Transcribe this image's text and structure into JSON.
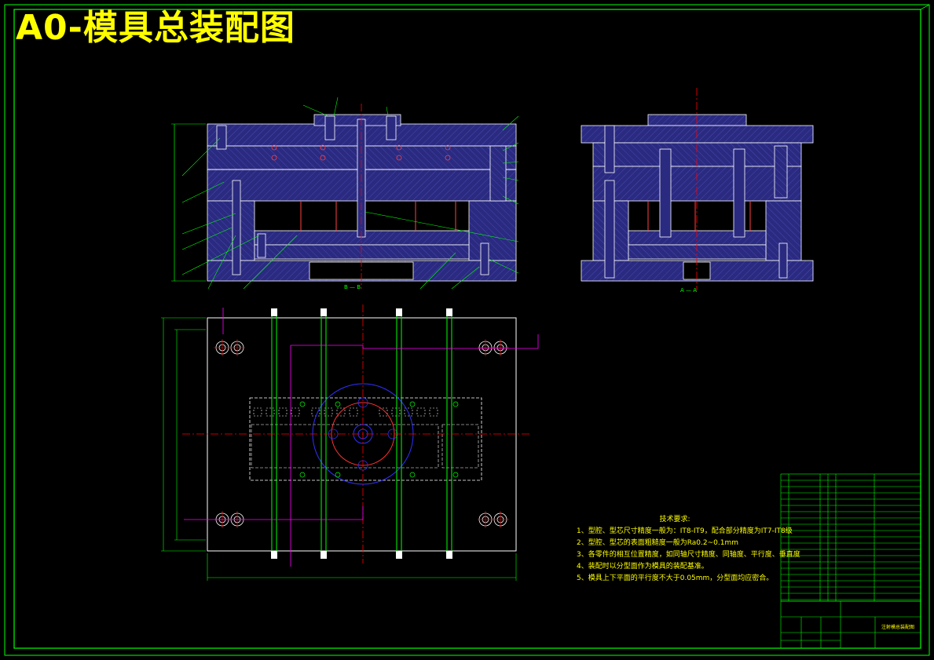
{
  "drawing": {
    "title": "A0-模具总装配图",
    "tech_requirements": {
      "heading": "技术要求:",
      "items": [
        "1、型腔、型芯尺寸精度一般为：IT8-IT9，配合部分精度为IT7-IT8级",
        "2、型腔、型芯的表面粗糙度一般为Ra0.2~0.1mm",
        "3、各零件的相互位置精度，如同轴尺寸精度、同轴度、平行度、垂直度",
        "4、装配时以分型面作为模具的装配基准。",
        "5、模具上下平面的平行度不大于0.05mm，分型面均应密合。"
      ]
    },
    "section_labels": {
      "main_view": "B — B",
      "side_view": "A — A"
    },
    "title_block": {
      "drawing_name": "注射模总装配图"
    },
    "colors": {
      "background": "#000000",
      "border": "#00ff00",
      "body_fill": "#2a2a80",
      "centerline": "#ff0000",
      "annotation": "#ffff00",
      "dimension": "#00ff00",
      "hidden": "#ffffff",
      "magenta": "#ff00ff",
      "circle": "#0000ff"
    }
  }
}
